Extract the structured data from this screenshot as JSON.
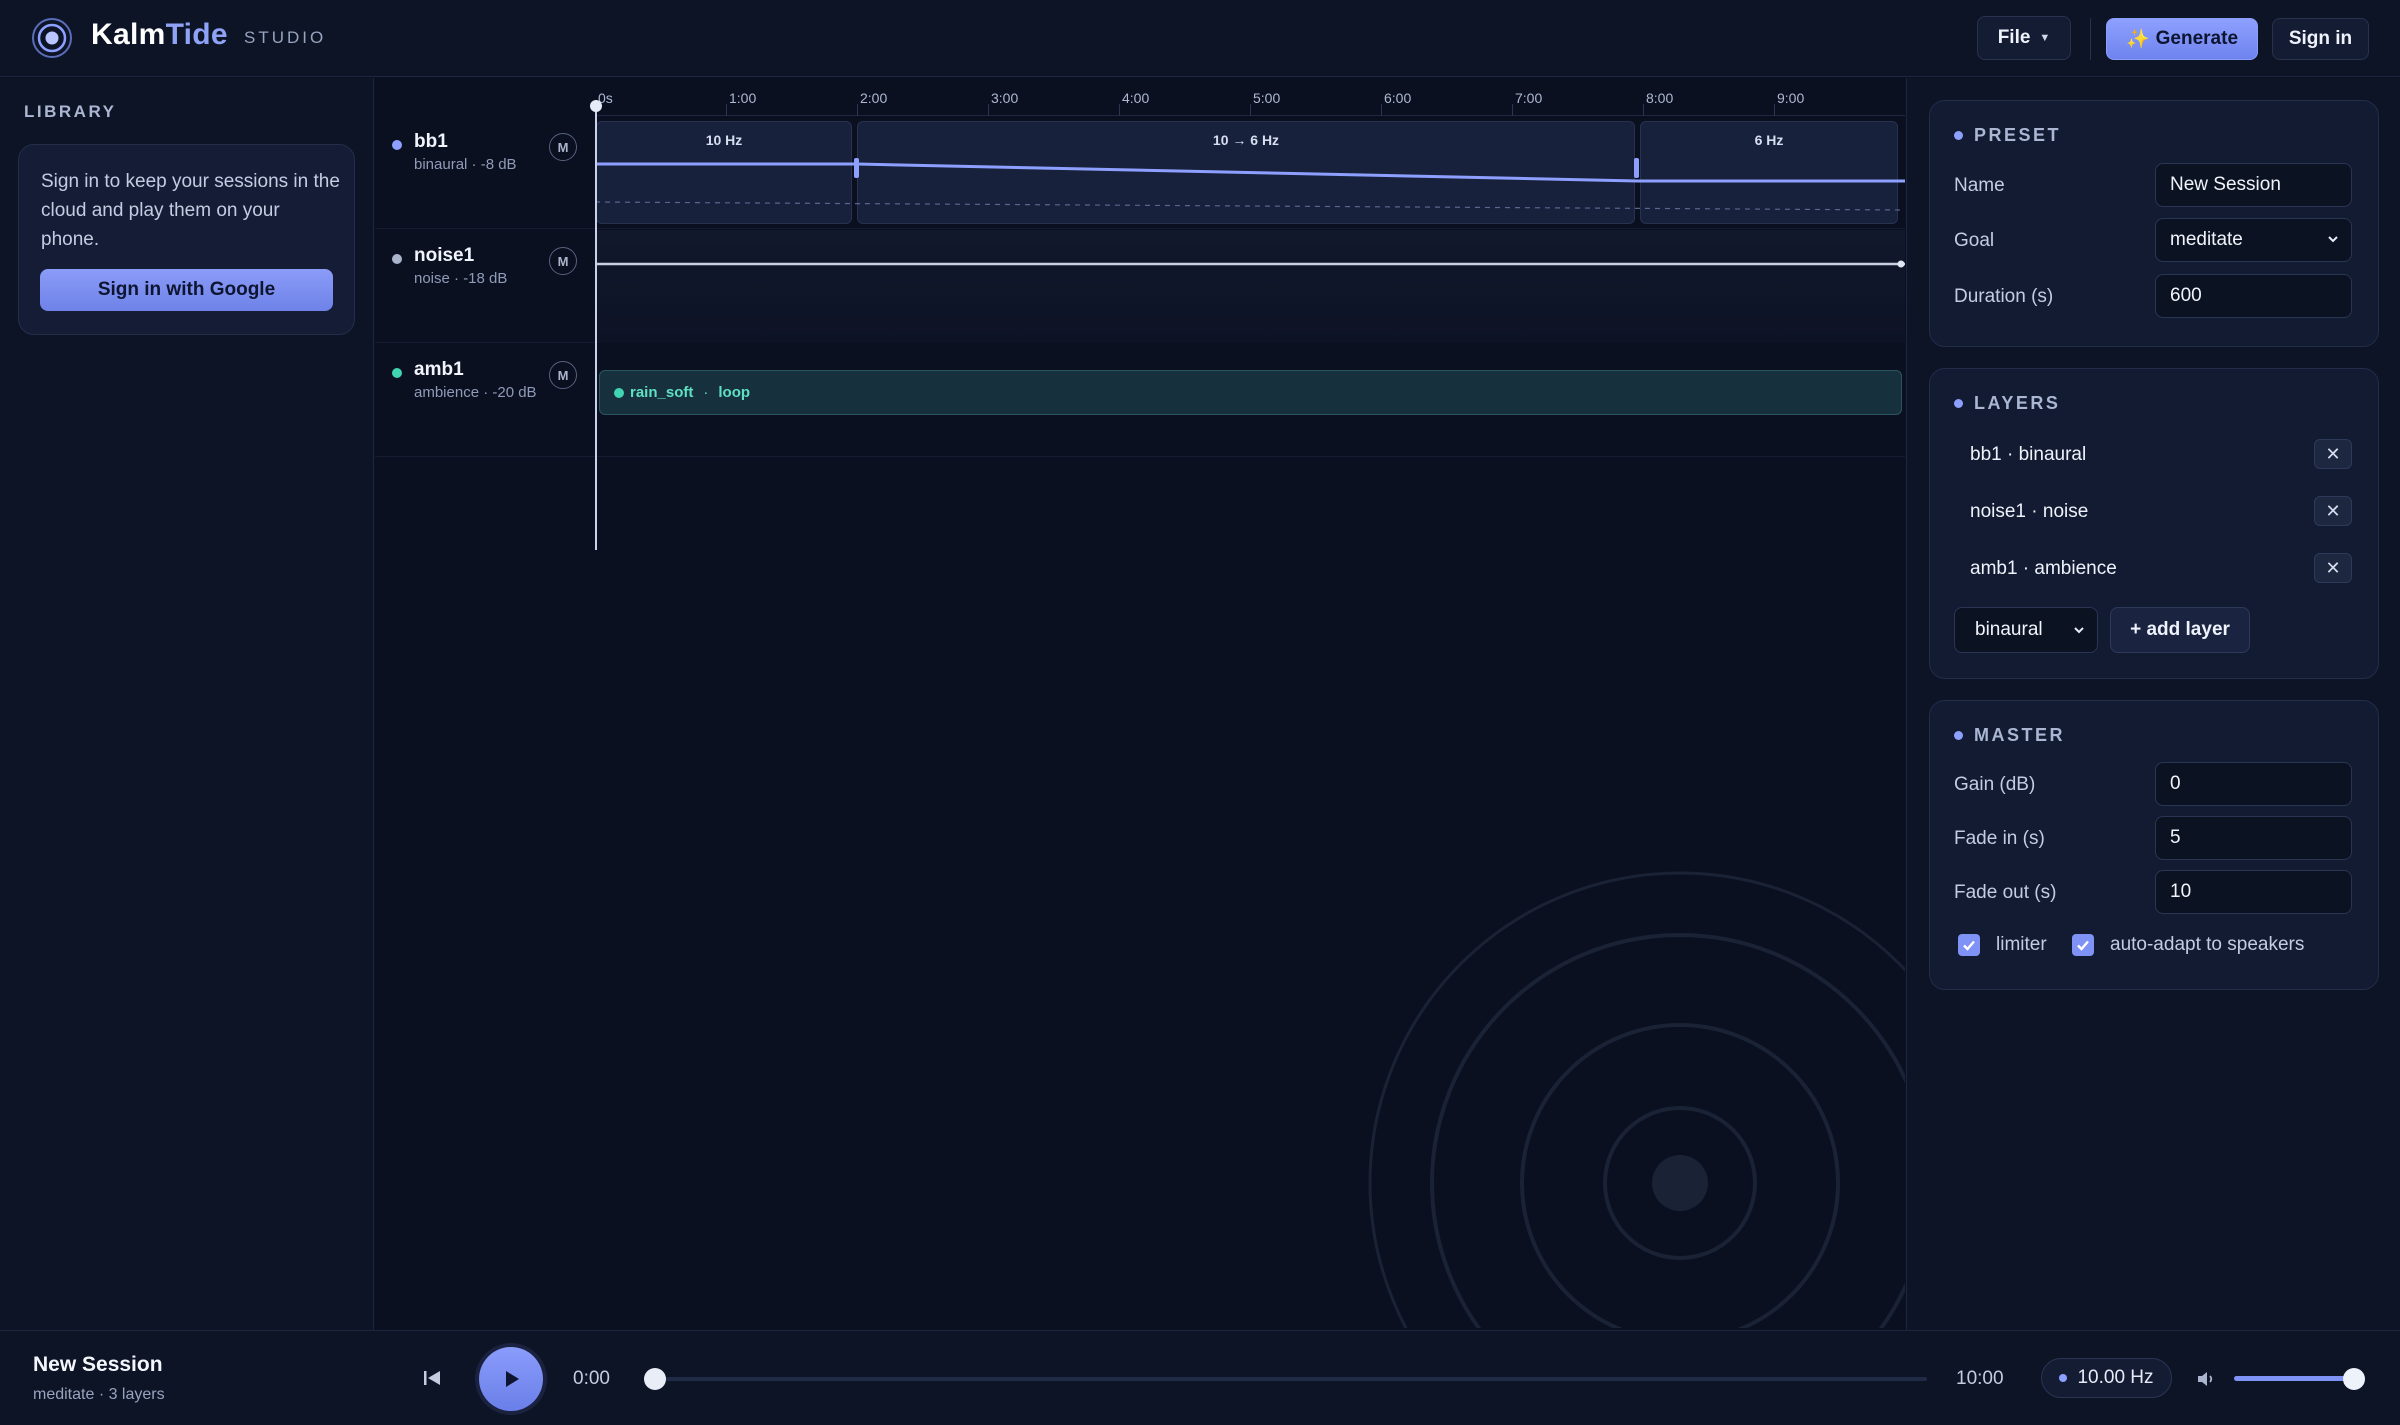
{
  "app": {
    "name_part1": "Kalm",
    "name_part2": "Tide",
    "subtitle": "STUDIO"
  },
  "toolbar": {
    "file_label": "File",
    "generate_label": "Generate",
    "signin_label": "Sign in"
  },
  "library": {
    "title": "LIBRARY",
    "message": "Sign in to keep your sessions in the cloud and play them on your phone.",
    "google_button": "Sign in with Google"
  },
  "timeline": {
    "ticks": [
      "0s",
      "1:00",
      "2:00",
      "3:00",
      "4:00",
      "5:00",
      "6:00",
      "7:00",
      "8:00",
      "9:00"
    ],
    "tracks": [
      {
        "name": "bb1",
        "sub": "binaural · -8 dB",
        "mute": "M",
        "color": "#8ea0ff"
      },
      {
        "name": "noise1",
        "sub": "noise · -18 dB",
        "mute": "M",
        "color": "#aab4cc"
      },
      {
        "name": "amb1",
        "sub": "ambience · -20 dB",
        "mute": "M",
        "color": "#40d4b2"
      }
    ],
    "bb1_segments": [
      "10 Hz",
      "10 → 6 Hz",
      "6 Hz"
    ],
    "amb_clip": {
      "name": "rain_soft",
      "sep": "·",
      "mode": "loop"
    }
  },
  "preset": {
    "title": "PRESET",
    "name_label": "Name",
    "name_value": "New Session",
    "goal_label": "Goal",
    "goal_value": "meditate",
    "duration_label": "Duration (s)",
    "duration_value": "600"
  },
  "layers": {
    "title": "LAYERS",
    "items": [
      "bb1 · binaural",
      "noise1 · noise",
      "amb1 · ambience"
    ],
    "new_layer_type": "binaural",
    "add_label": "+ add layer"
  },
  "master": {
    "title": "MASTER",
    "gain_label": "Gain (dB)",
    "gain_value": "0",
    "fadein_label": "Fade in (s)",
    "fadein_value": "5",
    "fadeout_label": "Fade out (s)",
    "fadeout_value": "10",
    "limiter_label": "limiter",
    "limiter_checked": true,
    "adapt_label": "auto-adapt to speakers",
    "adapt_checked": true
  },
  "player": {
    "title": "New Session",
    "subtitle": "meditate · 3 layers",
    "current_time": "0:00",
    "total_time": "10:00",
    "frequency": "10.00 Hz",
    "progress": 0,
    "volume": 1.0
  },
  "colors": {
    "accent": "#8ea0ff",
    "ambience": "#40d4b2"
  }
}
